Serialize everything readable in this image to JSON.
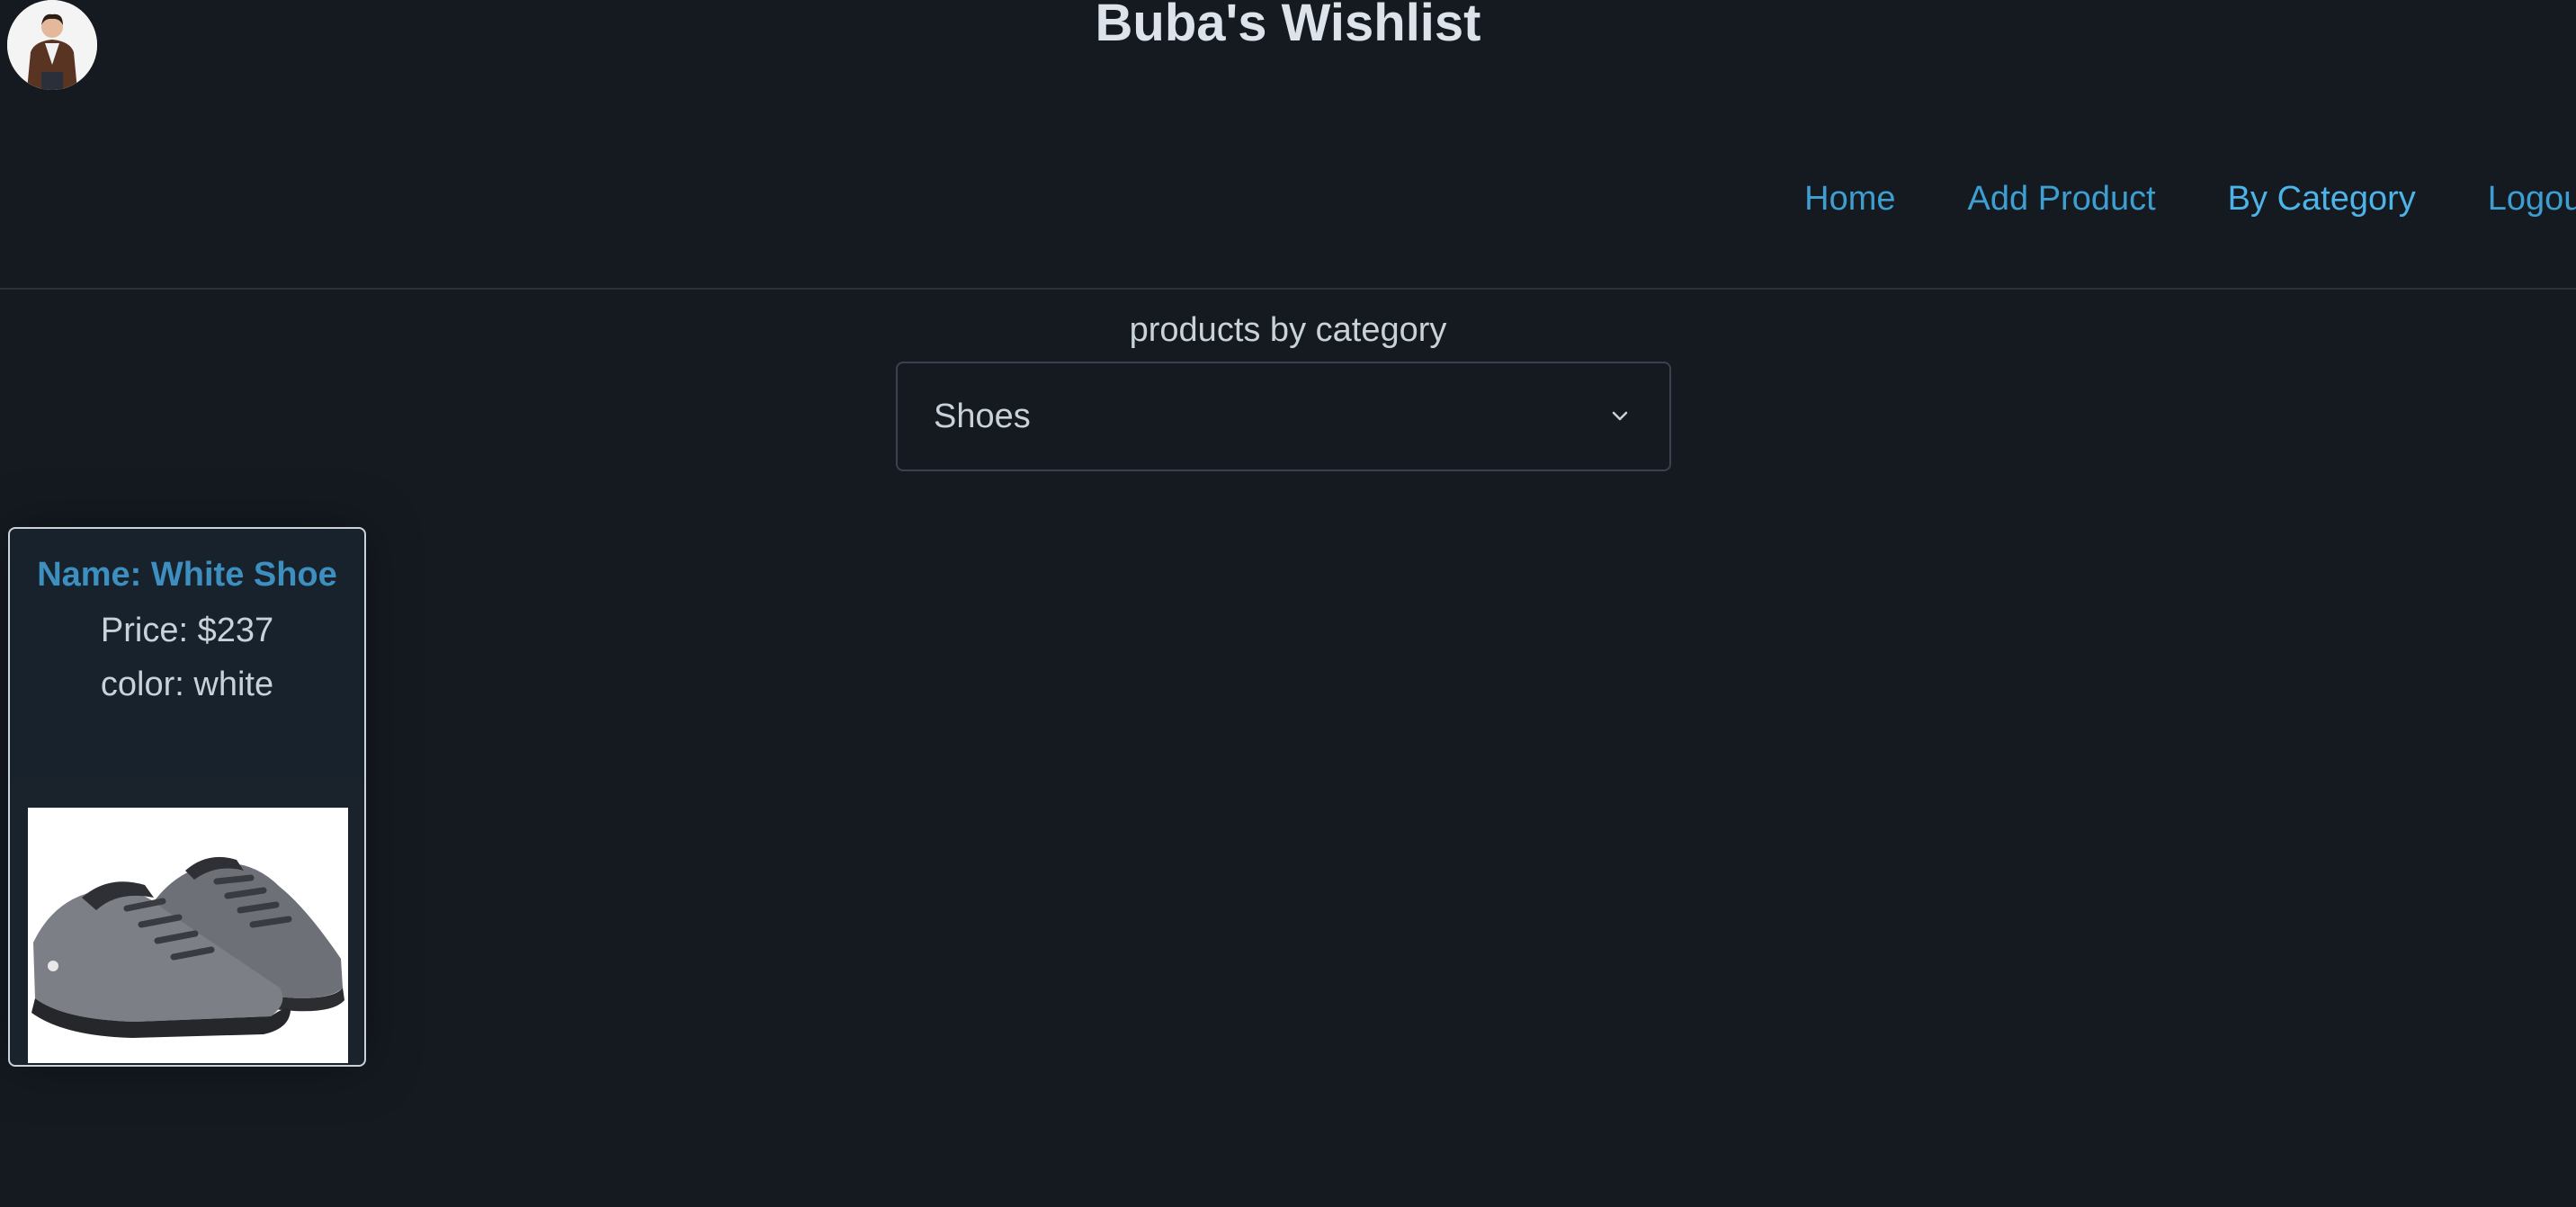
{
  "header": {
    "title": "Buba's Wishlist",
    "avatar_icon": "user-avatar-icon"
  },
  "nav": {
    "items": [
      {
        "label": "Home"
      },
      {
        "label": "Add Product"
      },
      {
        "label": "By Category"
      },
      {
        "label": "Logout"
      }
    ],
    "active": "By Category"
  },
  "main": {
    "section_label": "products by category",
    "category_select": {
      "selected": "Shoes",
      "icon": "chevron-down-icon"
    },
    "products": [
      {
        "name": "Name: White Shoe",
        "price": "Price: $237",
        "color": "color: white",
        "image_icon": "sneaker-icon"
      }
    ]
  },
  "colors": {
    "background": "#151a21",
    "link": "#3d9fd1",
    "product_name": "#3d8fc0",
    "text": "#c9d1d9"
  }
}
